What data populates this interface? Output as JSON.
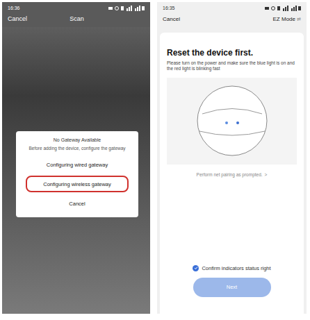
{
  "scan_screen": {
    "status_time": "16:36",
    "header": {
      "left": "Cancel",
      "title": "Scan"
    },
    "dialog": {
      "title": "No Gateway Available",
      "message": "Before adding the device, configure the gateway",
      "options": [
        {
          "label": "Configuring wired gateway",
          "selected": false
        },
        {
          "label": "Configuring wireless gateway",
          "selected": true
        },
        {
          "label": "Cancel",
          "selected": false
        }
      ]
    }
  },
  "reset_screen": {
    "status_time": "16:35",
    "header": {
      "left": "Cancel",
      "right": "EZ Mode",
      "right_icon": "⇌"
    },
    "title": "Reset the device first.",
    "instructions": "Please turn on the power and make sure the blue light is on and the red light is blinking fast",
    "hint": "Perform net pairing as prompted.",
    "hint_icon": ">",
    "confirm": {
      "label": "Confirm indicators status right",
      "checked": true
    },
    "button": {
      "label": "Next",
      "disabled": true
    }
  }
}
